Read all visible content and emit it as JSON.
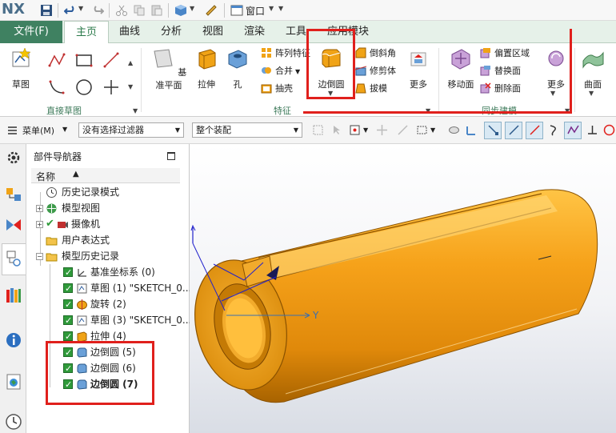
{
  "app": {
    "logo": "NX",
    "window_menu": "窗口"
  },
  "tabs": [
    "文件(F)",
    "主页",
    "曲线",
    "分析",
    "视图",
    "渲染",
    "工具",
    "应用模块"
  ],
  "ribbon": {
    "sketch": "草图",
    "direct_sketch_group": "直接草图",
    "datum_plane": "基准平面",
    "extrude": "拉伸",
    "hole": "孔",
    "pattern_feature": "阵列特征",
    "combine": "合并",
    "shell": "抽壳",
    "edge_blend": "边倒圆",
    "chamfer": "倒斜角",
    "trim_body": "修剪体",
    "draft": "拔模",
    "more": "更多",
    "feature_group": "特征",
    "move_face": "移动面",
    "offset_region": "偏置区域",
    "replace_face": "替换面",
    "delete_face": "删除面",
    "sync_group": "同步建模",
    "surface": "曲面",
    "more2": "更多"
  },
  "toolbar": {
    "menu": "菜单(M)",
    "filter": "没有选择过滤器",
    "assembly": "整个装配"
  },
  "navigator": {
    "title": "部件导航器",
    "column_name": "名称",
    "rows": [
      {
        "label": "历史记录模式"
      },
      {
        "label": "模型视图"
      },
      {
        "label": "摄像机"
      },
      {
        "label": "用户表达式"
      },
      {
        "label": "模型历史记录"
      },
      {
        "label": "基准坐标系 (0)"
      },
      {
        "label": "草图 (1) \"SKETCH_0..."
      },
      {
        "label": "旋转 (2)"
      },
      {
        "label": "草图 (3) \"SKETCH_0..."
      },
      {
        "label": "拉伸 (4)"
      },
      {
        "label": "边倒圆 (5)"
      },
      {
        "label": "边倒圆 (6)"
      },
      {
        "label": "边倒圆 (7)"
      }
    ]
  },
  "viewport": {
    "triad_y": "Y",
    "model_color": "#f0a316",
    "highlight_color": "#e0201c"
  }
}
